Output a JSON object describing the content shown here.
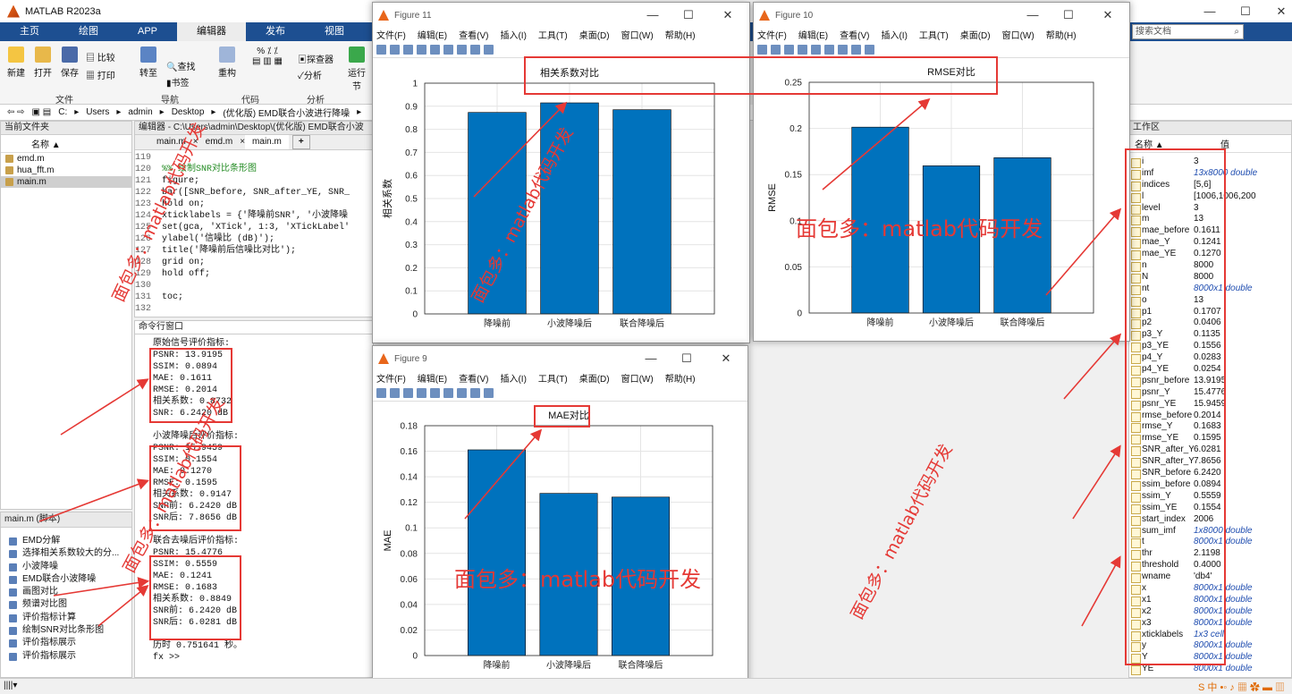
{
  "app": {
    "title": "MATLAB R2023a"
  },
  "ribbon_tabs": [
    "主页",
    "绘图",
    "APP",
    "编辑器",
    "发布",
    "视图"
  ],
  "ribbon": {
    "buttons": [
      "新建",
      "打开",
      "保存",
      "比较",
      "打印",
      "转至",
      "查找",
      "书签",
      "重构",
      "探查器",
      "分析",
      "运行节"
    ],
    "groups": [
      "文件",
      "导航",
      "代码",
      "分析"
    ]
  },
  "search_placeholder": "搜索文档",
  "address": {
    "crumbs": [
      "C:",
      "Users",
      "admin",
      "Desktop",
      "(优化版) EMD联合小波进行降噪"
    ]
  },
  "current_folder": {
    "title": "当前文件夹",
    "header": "名称 ▲",
    "files": [
      "emd.m",
      "hua_fft.m",
      "main.m"
    ]
  },
  "editor": {
    "title": "编辑器 - C:\\Users\\admin\\Desktop\\(优化版) EMD联合小波",
    "tabs": [
      "main.m",
      "emd.m",
      "main.m"
    ],
    "lines": [
      {
        "n": "119",
        "t": ""
      },
      {
        "n": "120",
        "t": "%% 绘制SNR对比条形图"
      },
      {
        "n": "121",
        "t": "figure;"
      },
      {
        "n": "122",
        "t": "bar([SNR_before, SNR_after_YE, SNR_"
      },
      {
        "n": "123",
        "t": "hold on;"
      },
      {
        "n": "124",
        "t": "xticklabels = {'降噪前SNR', '小波降噪"
      },
      {
        "n": "125",
        "t": "set(gca, 'XTick', 1:3, 'XTickLabel'"
      },
      {
        "n": "126",
        "t": "ylabel('信噪比 (dB)');"
      },
      {
        "n": "127",
        "t": "title('降噪前后信噪比对比');"
      },
      {
        "n": "128",
        "t": "grid on;"
      },
      {
        "n": "129",
        "t": "hold off;"
      },
      {
        "n": "130",
        "t": ""
      },
      {
        "n": "131",
        "t": "toc;"
      },
      {
        "n": "132",
        "t": ""
      }
    ]
  },
  "command_window": {
    "title": "命令行窗口",
    "sections": [
      {
        "head": "原始信号评价指标:",
        "lines": [
          "PSNR: 13.9195",
          "SSIM: 0.0894",
          "MAE: 0.1611",
          "RMSE: 0.2014",
          "相关系数: 0.8732",
          "SNR: 6.2420 dB"
        ]
      },
      {
        "head": "小波降噪后评价指标:",
        "lines": [
          "PSNR: 15.9459",
          "SSIM: 0.1554",
          "MAE: 0.1270",
          "RMSE: 0.1595",
          "相关系数: 0.9147",
          "SNR前: 6.2420 dB",
          "SNR后: 7.8656 dB"
        ]
      },
      {
        "head": "联合去噪后评价指标:",
        "lines": [
          "PSNR: 15.4776",
          "SSIM: 0.5559",
          "MAE: 0.1241",
          "RMSE: 0.1683",
          "相关系数: 0.8849",
          "SNR前: 6.2420 dB",
          "SNR后: 6.0281 dB"
        ]
      }
    ],
    "elapsed": "历时 0.751641 秒。",
    "prompt": ">>"
  },
  "outline": {
    "title": "main.m (脚本)",
    "items": [
      "EMD分解",
      "选择相关系数较大的分...",
      "小波降噪",
      "EMD联合小波降噪",
      "画图对比",
      "频谱对比图",
      "评价指标计算",
      "绘制SNR对比条形图",
      "评价指标展示",
      "评价指标展示"
    ]
  },
  "workspace": {
    "title": "工作区",
    "headers": [
      "名称 ▲",
      "值"
    ],
    "vars": [
      [
        "i",
        "3"
      ],
      [
        "imf",
        "13x8000 double"
      ],
      [
        "indices",
        "[5,6]"
      ],
      [
        "l",
        "[1006,1006,200"
      ],
      [
        "level",
        "3"
      ],
      [
        "m",
        "13"
      ],
      [
        "mae_before",
        "0.1611"
      ],
      [
        "mae_Y",
        "0.1241"
      ],
      [
        "mae_YE",
        "0.1270"
      ],
      [
        "n",
        "8000"
      ],
      [
        "N",
        "8000"
      ],
      [
        "nt",
        "8000x1 double"
      ],
      [
        "o",
        "13"
      ],
      [
        "p1",
        "0.1707"
      ],
      [
        "p2",
        "0.0406"
      ],
      [
        "p3_Y",
        "0.1135"
      ],
      [
        "p3_YE",
        "0.1556"
      ],
      [
        "p4_Y",
        "0.0283"
      ],
      [
        "p4_YE",
        "0.0254"
      ],
      [
        "psnr_before",
        "13.9195"
      ],
      [
        "psnr_Y",
        "15.4776"
      ],
      [
        "psnr_YE",
        "15.9459"
      ],
      [
        "rmse_before",
        "0.2014"
      ],
      [
        "rmse_Y",
        "0.1683"
      ],
      [
        "rmse_YE",
        "0.1595"
      ],
      [
        "SNR_after_Y",
        "6.0281"
      ],
      [
        "SNR_after_YE",
        "7.8656"
      ],
      [
        "SNR_before",
        "6.2420"
      ],
      [
        "ssim_before",
        "0.0894"
      ],
      [
        "ssim_Y",
        "0.5559"
      ],
      [
        "ssim_YE",
        "0.1554"
      ],
      [
        "start_index",
        "2006"
      ],
      [
        "sum_imf",
        "1x8000 double"
      ],
      [
        "t",
        "8000x1 double"
      ],
      [
        "thr",
        "2.1198"
      ],
      [
        "threshold",
        "0.4000"
      ],
      [
        "wname",
        "'db4'"
      ],
      [
        "x",
        "8000x1 double"
      ],
      [
        "x1",
        "8000x1 double"
      ],
      [
        "x2",
        "8000x1 double"
      ],
      [
        "x3",
        "8000x1 double"
      ],
      [
        "xticklabels",
        "1x3 cell"
      ],
      [
        "y",
        "8000x1 double"
      ],
      [
        "Y",
        "8000x1 double"
      ],
      [
        "YE",
        "8000x1 double"
      ]
    ]
  },
  "figure_menu": [
    "文件(F)",
    "编辑(E)",
    "查看(V)",
    "插入(I)",
    "工具(T)",
    "桌面(D)",
    "窗口(W)",
    "帮助(H)"
  ],
  "watermark": "面包多：matlab代码开发",
  "chart_data": [
    {
      "window_title": "Figure 11",
      "type": "bar",
      "title": "相关系数对比",
      "categories": [
        "降噪前",
        "小波降噪后",
        "联合降噪后"
      ],
      "values": [
        0.8732,
        0.9147,
        0.8849
      ],
      "xlabel": "",
      "ylabel": "相关系数",
      "ylim": [
        0,
        1
      ],
      "yticks": [
        "0",
        "0.1",
        "0.2",
        "0.3",
        "0.4",
        "0.5",
        "0.6",
        "0.7",
        "0.8",
        "0.9",
        "1"
      ],
      "grid": true,
      "color": "#0072bd"
    },
    {
      "window_title": "Figure 10",
      "type": "bar",
      "title": "RMSE对比",
      "categories": [
        "降噪前",
        "小波降噪后",
        "联合降噪后"
      ],
      "values": [
        0.2014,
        0.1595,
        0.1683
      ],
      "xlabel": "",
      "ylabel": "RMSE",
      "ylim": [
        0,
        0.25
      ],
      "yticks": [
        "0",
        "0.05",
        "0.1",
        "0.15",
        "0.2",
        "0.25"
      ],
      "grid": true,
      "color": "#0072bd"
    },
    {
      "window_title": "Figure 9",
      "type": "bar",
      "title": "MAE对比",
      "categories": [
        "降噪前",
        "小波降噪后",
        "联合降噪后"
      ],
      "values": [
        0.1611,
        0.127,
        0.1241
      ],
      "xlabel": "",
      "ylabel": "MAE",
      "ylim": [
        0,
        0.18
      ],
      "yticks": [
        "0",
        "0.02",
        "0.04",
        "0.06",
        "0.08",
        "0.1",
        "0.12",
        "0.14",
        "0.16",
        "0.18"
      ],
      "grid": true,
      "color": "#0072bd"
    }
  ]
}
